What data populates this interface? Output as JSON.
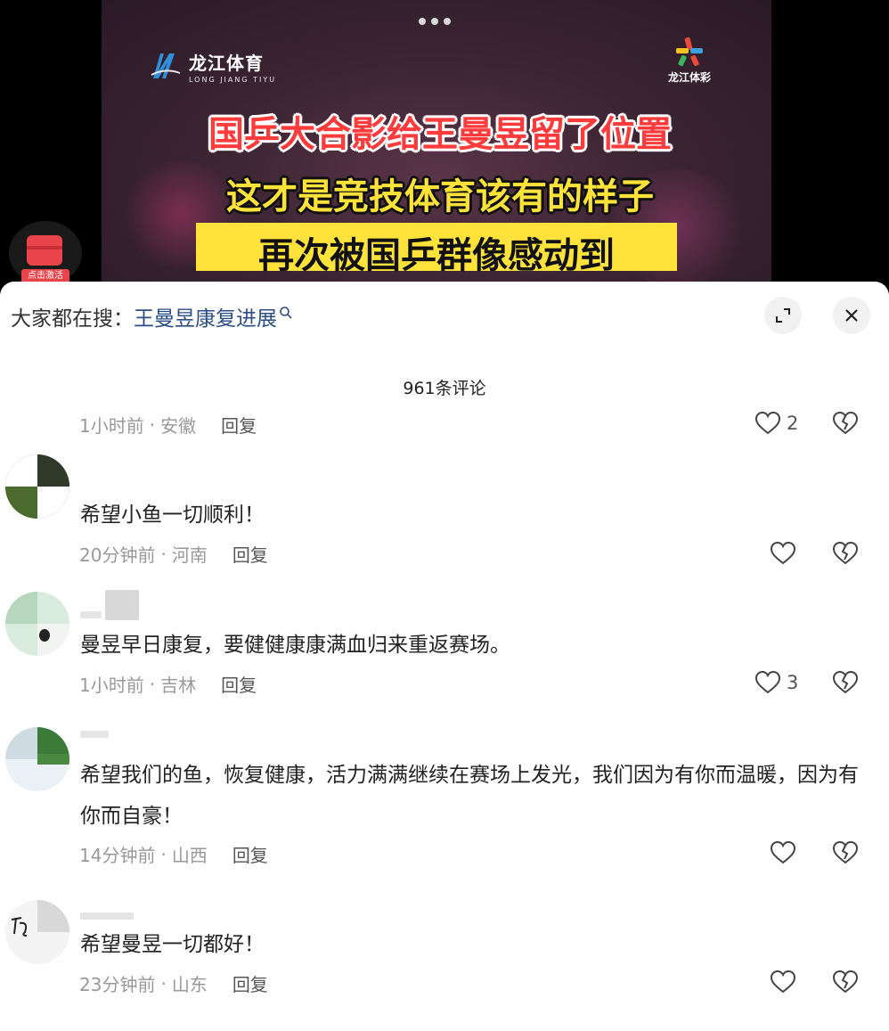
{
  "video": {
    "logo_left_name": "龙江体育",
    "logo_left_sub": "LONG JIANG TIYU",
    "logo_right_text": "龙江体彩",
    "caption_line1": "国乒大合影给王曼昱留了位置",
    "caption_line2": "这才是竞技体育该有的样子",
    "caption_line3": "再次被国乒群像感动到",
    "redpacket_label": "点击激活"
  },
  "sheet": {
    "search_label": "大家都在搜：",
    "search_term": "王曼昱康复进展",
    "comment_count_label": "961条评论"
  },
  "comments": [
    {
      "text": "",
      "time": "1小时前",
      "region": "安徽",
      "reply_label": "回复",
      "likes": "2"
    },
    {
      "text": "希望小鱼一切顺利！",
      "time": "20分钟前",
      "region": "河南",
      "reply_label": "回复",
      "likes": ""
    },
    {
      "text": "曼昱早日康复，要健健康康满血归来重返赛场。",
      "time": "1小时前",
      "region": "吉林",
      "reply_label": "回复",
      "likes": "3"
    },
    {
      "text": "希望我们的鱼，恢复健康，活力满满继续在赛场上发光，我们因为有你而温暖，因为有你而自豪！",
      "time": "14分钟前",
      "region": "山西",
      "reply_label": "回复",
      "likes": ""
    },
    {
      "text": "希望曼昱一切都好！",
      "time": "23分钟前",
      "region": "山东",
      "reply_label": "回复",
      "likes": ""
    }
  ],
  "meta_separator": "·",
  "colors": {
    "search_term": "#2d4d86",
    "caption_red": "#ff3b3b",
    "caption_yellow": "#ffe23a",
    "meta_gray": "#999999"
  },
  "icons": [
    "search-icon",
    "expand-icon",
    "close-icon",
    "heart-icon",
    "broken-heart-icon"
  ]
}
